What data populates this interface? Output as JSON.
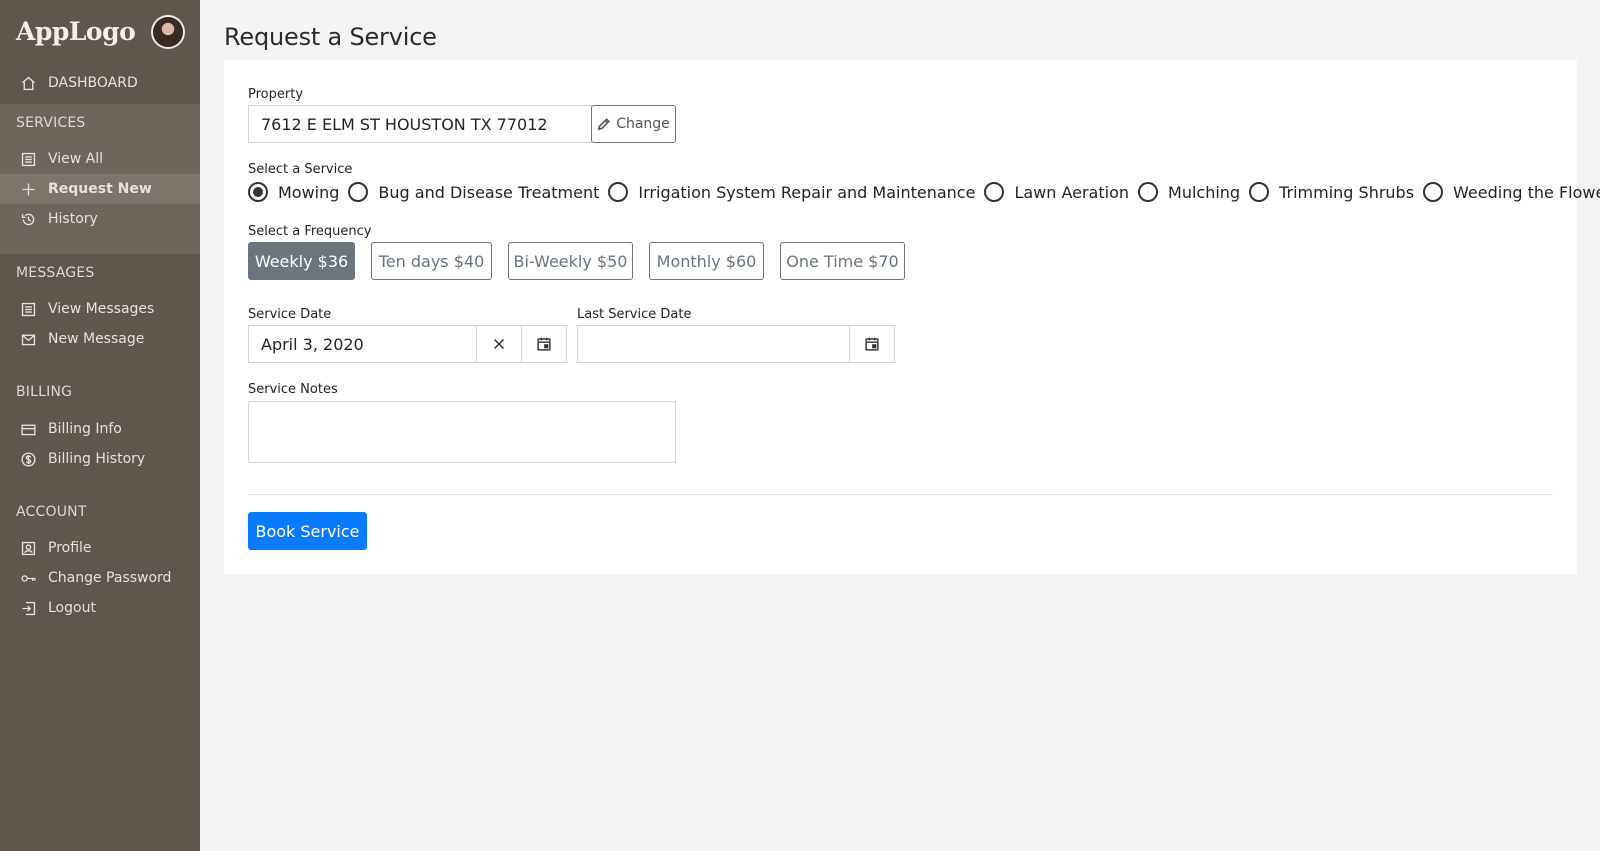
{
  "app": {
    "logo": "AppLogo",
    "avatar_alt": "user avatar"
  },
  "sidebar": {
    "dashboard": "DASHBOARD",
    "sections": [
      {
        "label": "SERVICES",
        "items": [
          {
            "label": "View All",
            "icon": "list-icon"
          },
          {
            "label": "Request New",
            "icon": "plus-icon",
            "active": true
          },
          {
            "label": "History",
            "icon": "history-icon"
          }
        ]
      },
      {
        "label": "MESSAGES",
        "items": [
          {
            "label": "View Messages",
            "icon": "list-icon"
          },
          {
            "label": "New Message",
            "icon": "mail-icon"
          }
        ]
      },
      {
        "label": "BILLING",
        "items": [
          {
            "label": "Billing Info",
            "icon": "credit-card-icon"
          },
          {
            "label": "Billing History",
            "icon": "dollar-circle-icon"
          }
        ]
      },
      {
        "label": "ACCOUNT",
        "items": [
          {
            "label": "Profile",
            "icon": "profile-icon"
          },
          {
            "label": "Change Password",
            "icon": "key-icon"
          },
          {
            "label": "Logout",
            "icon": "logout-icon"
          }
        ]
      }
    ]
  },
  "page": {
    "title": "Request a Service"
  },
  "form": {
    "property_label": "Property",
    "property_value": "7612 E ELM ST HOUSTON TX 77012",
    "change_label": "Change",
    "service_label": "Select a Service",
    "services": [
      "Mowing",
      "Bug and Disease Treatment",
      "Irrigation System Repair and Maintenance",
      "Lawn Aeration",
      "Mulching",
      "Trimming Shrubs",
      "Weeding the Flower Bed"
    ],
    "selected_service": "Mowing",
    "frequency_label": "Select a Frequency",
    "frequencies": [
      "Weekly $36",
      "Ten days $40",
      "Bi-Weekly $50",
      "Monthly $60",
      "One Time $70"
    ],
    "selected_frequency": "Weekly $36",
    "service_date_label": "Service Date",
    "service_date_value": "April 3, 2020",
    "last_service_date_label": "Last Service Date",
    "last_service_date_value": "",
    "notes_label": "Service Notes",
    "notes_value": "",
    "submit_label": "Book Service"
  },
  "colors": {
    "sidebar": "#5f564d",
    "primary": "#0a7bff",
    "selected": "#6c757d"
  }
}
